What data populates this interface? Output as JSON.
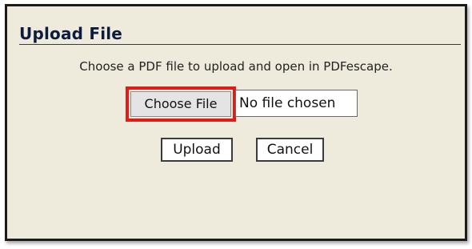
{
  "dialog": {
    "title": "Upload File",
    "instructions": "Choose a PDF file to upload and open in PDFescape.",
    "file_input": {
      "button_label": "Choose File",
      "status_text": "No file chosen",
      "highlighted": true
    },
    "buttons": {
      "upload_label": "Upload",
      "cancel_label": "Cancel"
    }
  },
  "colors": {
    "dialog_background": "#efebdc",
    "dialog_border": "#1c1c1c",
    "title_text": "#0d1b3e",
    "highlight": "#e21b16"
  }
}
